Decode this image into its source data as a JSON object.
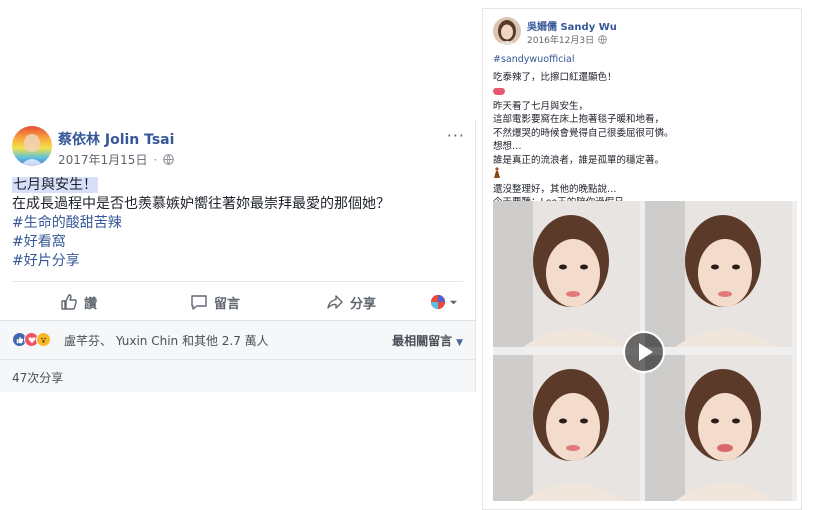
{
  "left_post": {
    "author": "蔡依林 Jolin Tsai",
    "date": "2017年1月15日",
    "date_separator": "·",
    "text_highlight": "七月與安生！",
    "text_line2": "在成長過程中是否也羨慕嫉妒嚮往著妳最崇拜最愛的那個她？",
    "hashtags": [
      "#生命的酸甜苦辣",
      "#好看窩",
      "#好片分享"
    ],
    "actions": {
      "like": "讚",
      "comment": "留言",
      "share": "分享"
    },
    "reaction_summary": "盧芊芬、 Yuxin Chin 和其他 2.7 萬人",
    "sort_label": "最相關留言",
    "shares_count": "47次分享",
    "more_icon": "···"
  },
  "right_post": {
    "author": "吳姍儒 Sandy Wu",
    "date": "2016年12月3日",
    "hashtag": "#sandywuofficial",
    "lines": [
      "吃泰辣了，比擦口紅還顯色！",
      "昨天看了七月與安生，",
      "這部電影要窩在床上抱著毯子暖和地看，",
      "不然爆哭的時候會覺得自己很委屈很可憐。",
      "想想…",
      "誰是真正的流浪者，誰是孤單的穩定著。",
      "還沒整理好，其他的晚點說…",
      "今天要聽：Leo王的陪你過假日"
    ]
  },
  "icons": {
    "globe": "globe-icon",
    "like": "thumbs-up-icon",
    "comment": "speech-bubble-icon",
    "share": "share-arrow-icon",
    "play": "play-icon"
  },
  "colors": {
    "link_blue": "#365899",
    "meta_gray": "#616770",
    "bar_bg": "#f6f7f9",
    "like_blue": "#4267b2",
    "love_red": "#f25268",
    "wow_yellow": "#f7b928"
  }
}
